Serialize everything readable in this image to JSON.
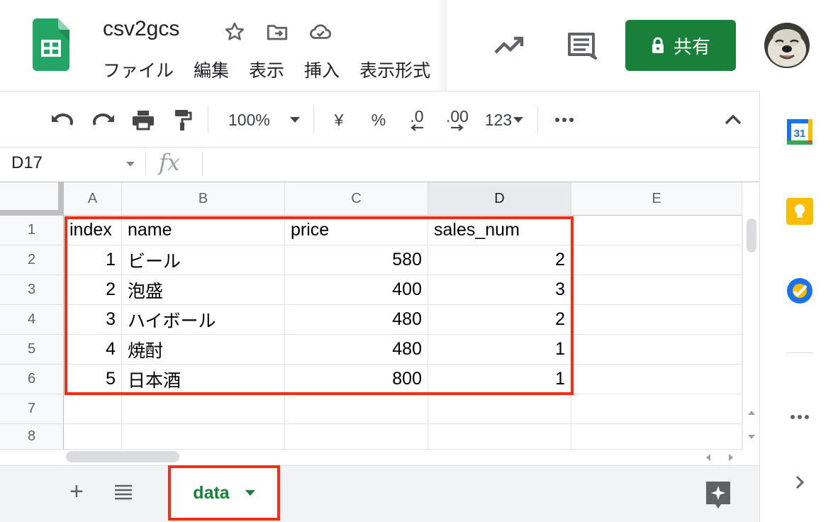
{
  "header": {
    "title": "csv2gcs",
    "menu": [
      "ファイル",
      "編集",
      "表示",
      "挿入",
      "表示形式"
    ],
    "share_label": "共有"
  },
  "toolbar": {
    "zoom": "100%",
    "currency": "¥",
    "percent": "%",
    "decrease_decimal": ".0",
    "increase_decimal": ".00",
    "more_formats": "123"
  },
  "formula_bar": {
    "cell_ref": "D17",
    "fx": "fx"
  },
  "grid": {
    "columns": [
      "A",
      "B",
      "C",
      "D",
      "E"
    ],
    "rows": [
      "1",
      "2",
      "3",
      "4",
      "5",
      "6",
      "7",
      "8"
    ],
    "active_column": "D",
    "cells": [
      [
        "index",
        "name",
        "price",
        "sales_num",
        ""
      ],
      [
        "1",
        "ビール",
        "580",
        "2",
        ""
      ],
      [
        "2",
        "泡盛",
        "400",
        "3",
        ""
      ],
      [
        "3",
        "ハイボール",
        "480",
        "2",
        ""
      ],
      [
        "4",
        "焼酎",
        "480",
        "1",
        ""
      ],
      [
        "5",
        "日本酒",
        "800",
        "1",
        ""
      ],
      [
        "",
        "",
        "",
        "",
        ""
      ],
      [
        "",
        "",
        "",
        "",
        ""
      ]
    ]
  },
  "sheets": {
    "active_tab": "data"
  },
  "side_panel": {
    "calendar_day": "31"
  },
  "colors": {
    "brand_green": "#188038",
    "highlight_red": "#ff2a14",
    "header_bg": "#f8f9fa"
  }
}
